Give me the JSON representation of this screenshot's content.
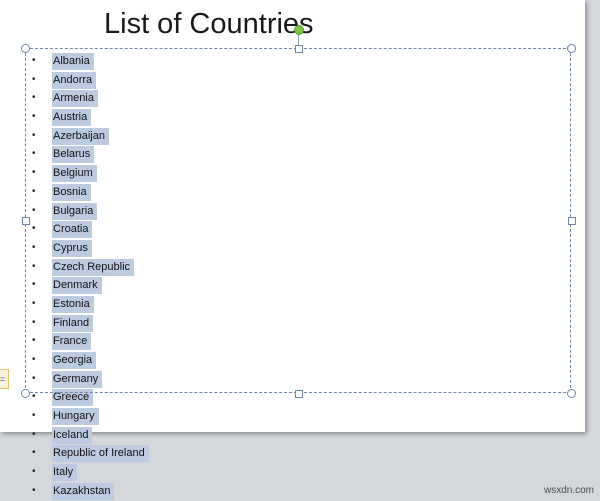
{
  "slide": {
    "title": "List of Countries",
    "countries": [
      "Albania",
      "Andorra",
      "Armenia",
      "Austria",
      "Azerbaijan",
      "Belarus",
      "Belgium",
      "Bosnia",
      "Bulgaria",
      "Croatia",
      "Cyprus",
      "Czech Republic",
      "Denmark",
      "Estonia",
      "Finland",
      "France",
      "Georgia",
      "Germany",
      "Greece",
      "Hungary",
      "Iceland",
      "Republic of Ireland",
      "Italy",
      "Kazakhstan"
    ],
    "bullet": "•"
  },
  "paste_options": {
    "glyph": "="
  },
  "watermark": "wsxdn.com",
  "colors": {
    "selection": "#bccbe0",
    "frame": "#6f86a4",
    "rotate_handle": "#7ec24a",
    "workspace": "#d4d8dd"
  },
  "icons": [
    "rotate-handle-icon",
    "resize-handle-icon",
    "paste-options-icon"
  ]
}
